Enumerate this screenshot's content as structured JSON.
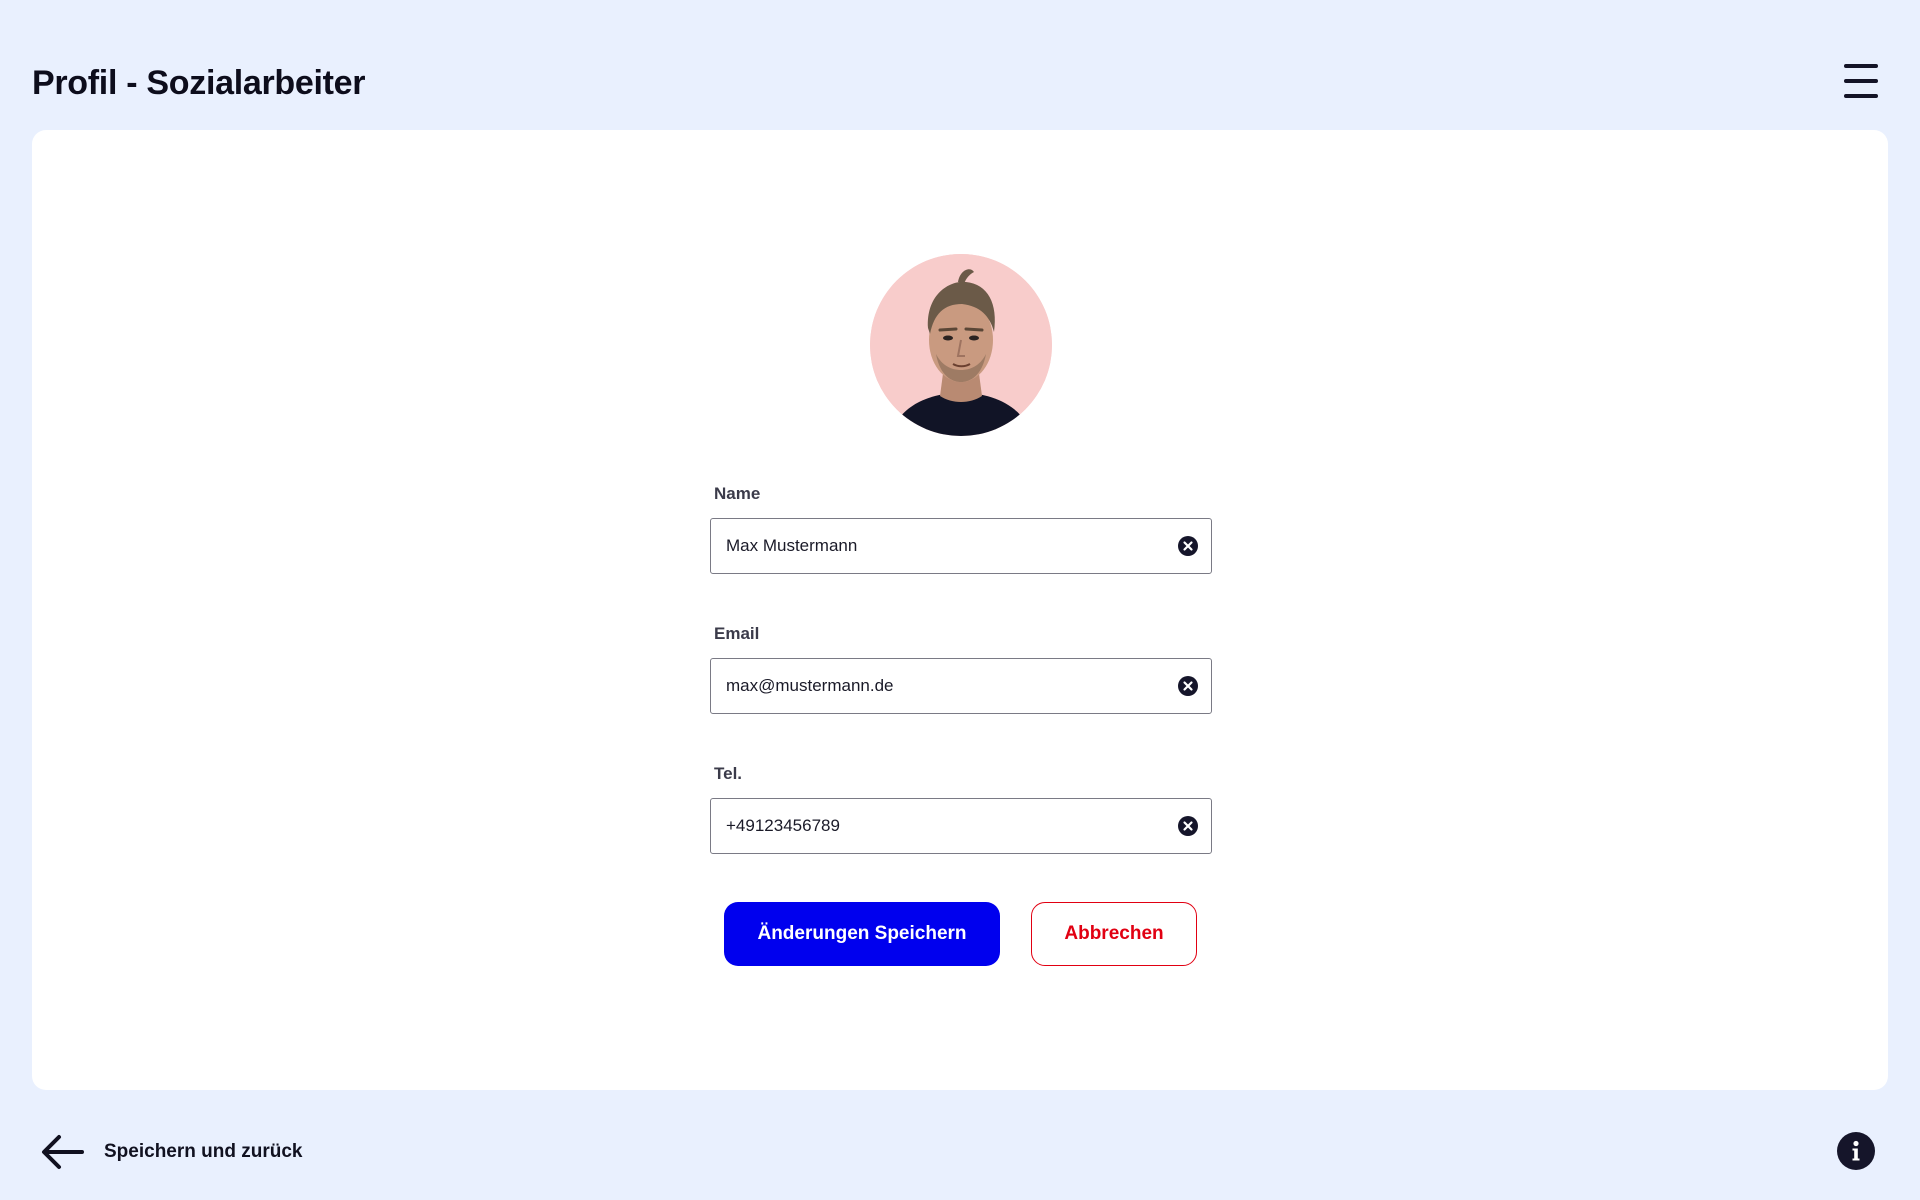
{
  "header": {
    "title": "Profil - Sozialarbeiter",
    "menu_icon": "hamburger-menu-icon"
  },
  "profile": {
    "avatar_icon": "profile-photo",
    "fields": {
      "name": {
        "label": "Name",
        "value": "Max Mustermann"
      },
      "email": {
        "label": "Email",
        "value": "max@mustermann.de"
      },
      "phone": {
        "label": "Tel.",
        "value": "+49123456789"
      }
    },
    "clear_icon": "clear-circle-x-icon"
  },
  "actions": {
    "save_label": "Änderungen Speichern",
    "cancel_label": "Abbrechen"
  },
  "footer": {
    "back_label": "Speichern und zurück",
    "back_icon": "arrow-left-icon",
    "info_icon": "info-icon"
  },
  "colors": {
    "background": "#e9f0fe",
    "primary": "#0000ee",
    "danger": "#e10012",
    "avatar_bg": "#f8cccb",
    "text_dark": "#0d0d1c"
  }
}
